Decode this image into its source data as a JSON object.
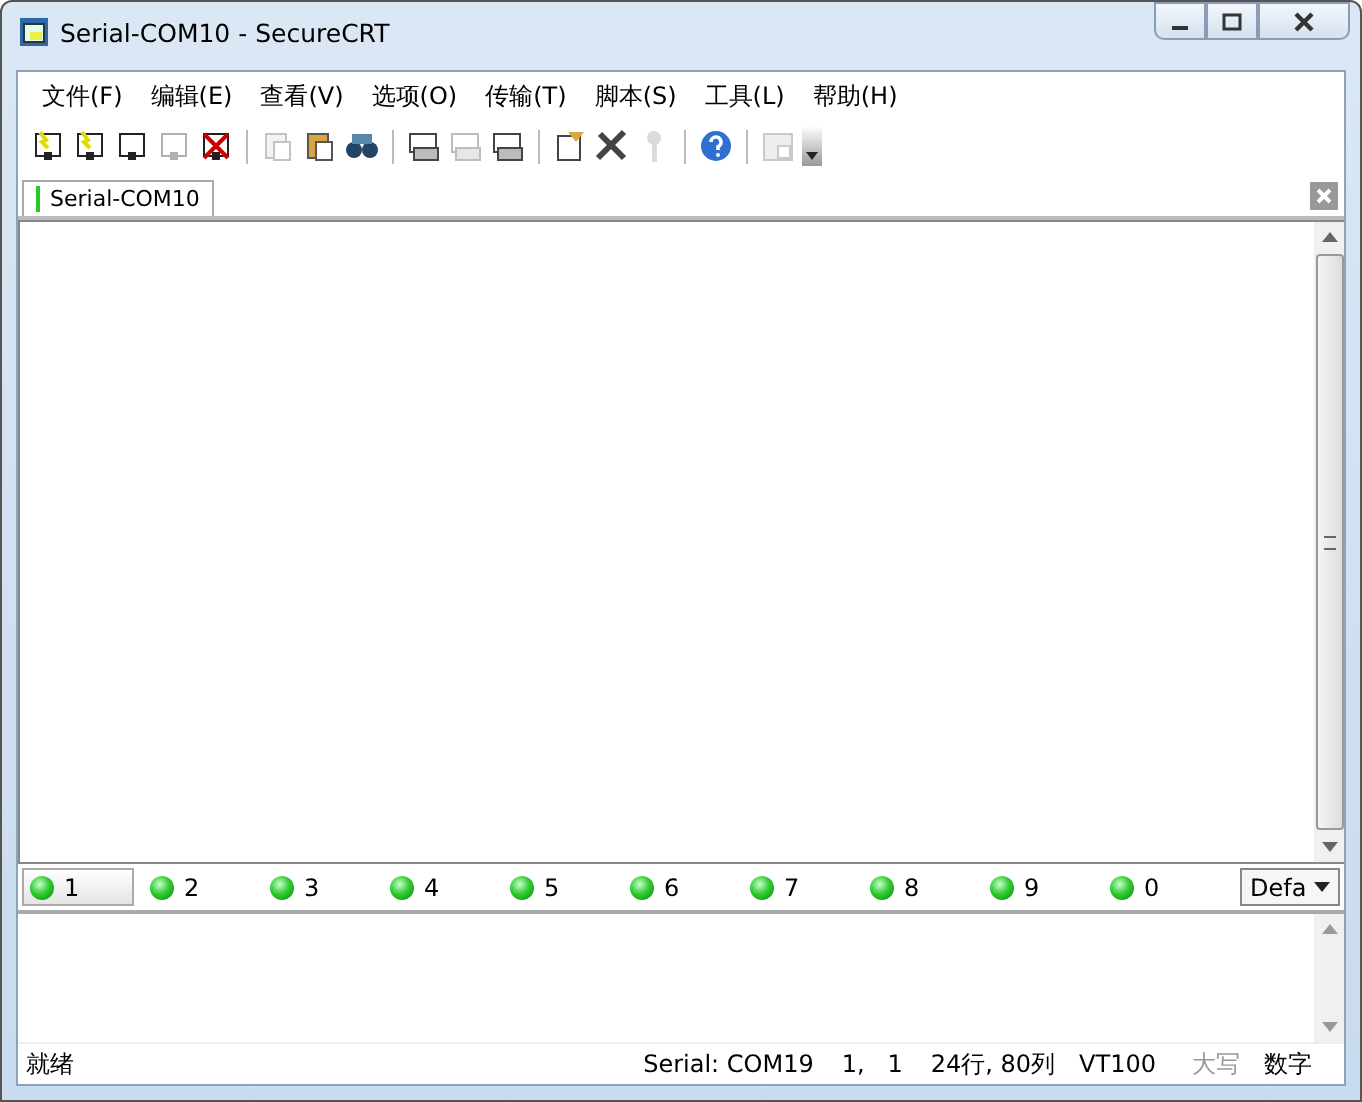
{
  "window": {
    "title": "Serial-COM10 - SecureCRT"
  },
  "menu": [
    "文件(F)",
    "编辑(E)",
    "查看(V)",
    "选项(O)",
    "传输(T)",
    "脚本(S)",
    "工具(L)",
    "帮助(H)"
  ],
  "toolbar": [
    [
      {
        "disabled": false
      },
      {
        "disabled": false
      },
      {
        "disabled": false
      },
      {
        "disabled": true
      },
      {
        "disabled": false
      }
    ],
    [
      {
        "disabled": true
      },
      {
        "disabled": false
      },
      {
        "disabled": false
      }
    ],
    [
      {
        "disabled": false
      },
      {
        "disabled": true
      },
      {
        "disabled": false
      }
    ],
    [
      {
        "disabled": false
      },
      {
        "disabled": false
      },
      {
        "disabled": true
      }
    ],
    [
      {
        "disabled": false
      }
    ],
    [
      {
        "disabled": true
      }
    ]
  ],
  "tabs": [
    {
      "label": "Serial-COM10",
      "selected": true
    }
  ],
  "button_bar": {
    "buttons": [
      {
        "label": "1",
        "selected": true
      },
      {
        "label": "2",
        "selected": false
      },
      {
        "label": "3",
        "selected": false
      },
      {
        "label": "4",
        "selected": false
      },
      {
        "label": "5",
        "selected": false
      },
      {
        "label": "6",
        "selected": false
      },
      {
        "label": "7",
        "selected": false
      },
      {
        "label": "8",
        "selected": false
      },
      {
        "label": "9",
        "selected": false
      },
      {
        "label": "0",
        "selected": false
      }
    ],
    "dropdown": "Defa"
  },
  "status_bar": [
    {
      "text": "就绪",
      "disabled": false
    },
    {
      "text": "Serial: COM19",
      "disabled": false
    },
    {
      "text": "1,   1",
      "disabled": false
    },
    {
      "text": "24行, 80列",
      "disabled": false
    },
    {
      "text": "VT100",
      "disabled": false
    },
    {
      "text": "大写",
      "disabled": true
    },
    {
      "text": "数字",
      "disabled": false
    }
  ]
}
